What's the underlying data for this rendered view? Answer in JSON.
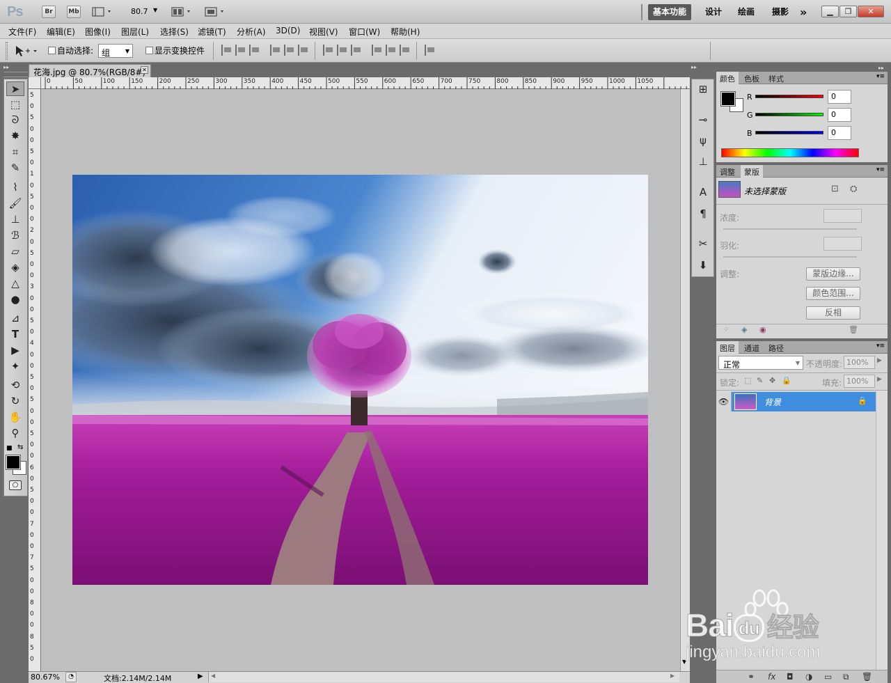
{
  "app": {
    "logo": "Ps",
    "bridge_btn": "Br",
    "minibridge_btn": "Mb",
    "zoom_value": "80.7",
    "workspaces": [
      "基本功能",
      "设计",
      "绘画",
      "摄影"
    ],
    "workspaces_more": "»"
  },
  "menu": [
    "文件(F)",
    "编辑(E)",
    "图像(I)",
    "图层(L)",
    "选择(S)",
    "滤镜(T)",
    "分析(A)",
    "3D(D)",
    "视图(V)",
    "窗口(W)",
    "帮助(H)"
  ],
  "options": {
    "auto_select_label": "自动选择:",
    "auto_select_value": "组",
    "show_transform_label": "显示变换控件"
  },
  "document": {
    "tab_title": "花海.jpg @ 80.7%(RGB/8#)",
    "ruler_top": [
      "50",
      "0",
      "50",
      "100",
      "150",
      "200",
      "250",
      "300",
      "350",
      "400",
      "450",
      "500",
      "550",
      "600",
      "650",
      "700",
      "750",
      "800",
      "850",
      "900",
      "950",
      "1000",
      "1050"
    ],
    "ruler_left": [
      "5",
      "0",
      "5",
      "0",
      "0",
      "5",
      "0",
      "1",
      "0",
      "5",
      "0",
      "0",
      "2",
      "0",
      "5",
      "0",
      "0",
      "3",
      "0",
      "0",
      "5",
      "0",
      "4",
      "0",
      "0",
      "5",
      "0",
      "5",
      "0",
      "0",
      "5",
      "0",
      "0",
      "6",
      "0",
      "5",
      "0",
      "0",
      "7",
      "0",
      "0",
      "7",
      "5",
      "0",
      "0",
      "8",
      "0",
      "0",
      "8",
      "5",
      "0"
    ],
    "zoom_status": "80.67%",
    "doc_status": "文档:2.14M/2.14M"
  },
  "color_panel": {
    "tabs": [
      "颜色",
      "色板",
      "样式"
    ],
    "r_label": "R",
    "g_label": "G",
    "b_label": "B",
    "r_value": "0",
    "g_value": "0",
    "b_value": "0"
  },
  "masks_panel": {
    "tabs": [
      "调整",
      "蒙版"
    ],
    "no_mask": "未选择蒙版",
    "density": "浓度:",
    "feather": "羽化:",
    "refine": "调整:",
    "mask_edge_btn": "蒙版边缘...",
    "color_range_btn": "颜色范围...",
    "invert_btn": "反相"
  },
  "layers_panel": {
    "tabs": [
      "图层",
      "通道",
      "路径"
    ],
    "blend_mode": "正常",
    "opacity_label": "不透明度:",
    "opacity_value": "100%",
    "lock_label": "锁定:",
    "fill_label": "填充:",
    "fill_value": "100%",
    "layer_name": "背景"
  },
  "watermark": {
    "brand": "Bai",
    "brand_tail": "du",
    "cn": "经验",
    "url": "jingyan.baidu.com"
  }
}
